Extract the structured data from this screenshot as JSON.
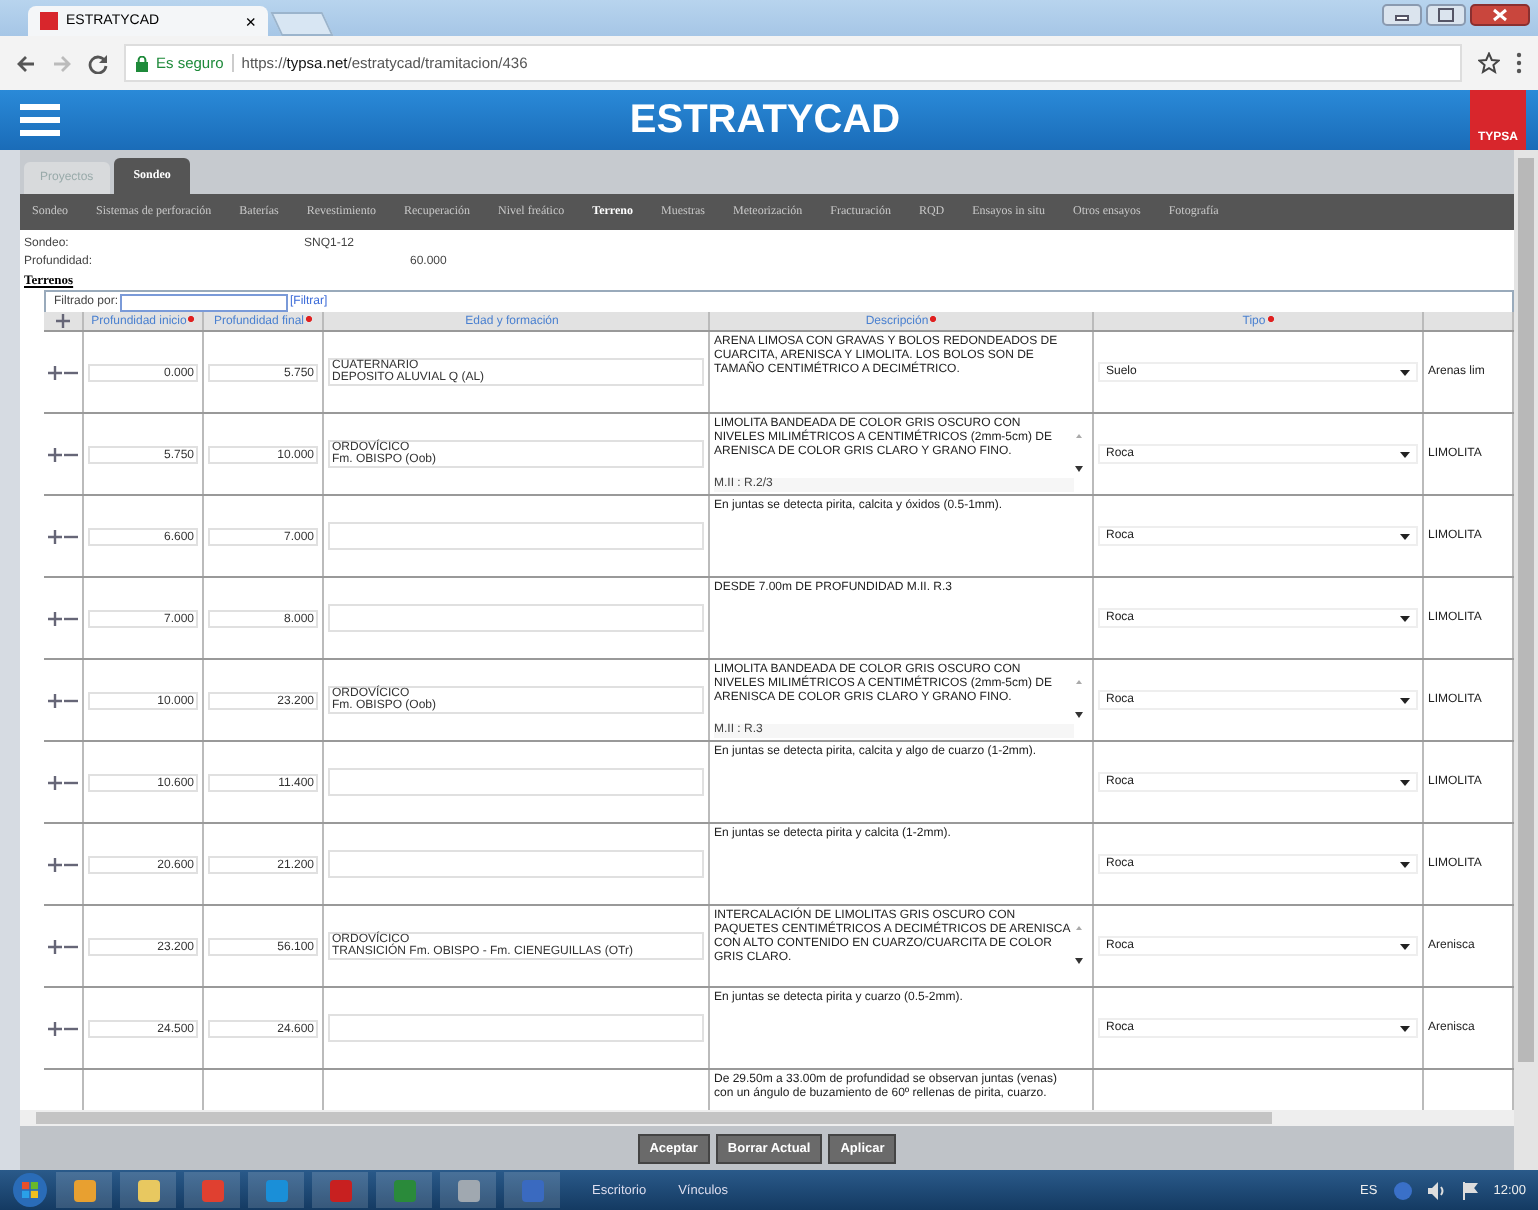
{
  "browser": {
    "tab_title": "ESTRATYCAD",
    "tab_close": "×",
    "secure_label": "Es seguro",
    "url": "https://**typsa.net**/estratycad/tramitacion/436"
  },
  "header": {
    "title": "ESTRATYCAD",
    "logo": "TYPSA"
  },
  "tabs": [
    {
      "label": "Proyectos",
      "selected": false
    },
    {
      "label": "Sondeo",
      "selected": true
    }
  ],
  "subnav": [
    {
      "label": "Sondeo",
      "selected": false
    },
    {
      "label": "Sistemas de perforación",
      "selected": false
    },
    {
      "label": "Baterías",
      "selected": false
    },
    {
      "label": "Revestimiento",
      "selected": false
    },
    {
      "label": "Recuperación",
      "selected": false
    },
    {
      "label": "Nivel freático",
      "selected": false
    },
    {
      "label": "Terreno",
      "selected": true
    },
    {
      "label": "Muestras",
      "selected": false
    },
    {
      "label": "Meteorización",
      "selected": false
    },
    {
      "label": "Fracturación",
      "selected": false
    },
    {
      "label": "RQD",
      "selected": false
    },
    {
      "label": "Ensayos in situ",
      "selected": false
    },
    {
      "label": "Otros ensayos",
      "selected": false
    },
    {
      "label": "Fotografía",
      "selected": false
    }
  ],
  "info": [
    {
      "label": "Sondeo:",
      "value": "SNQ1-12"
    },
    {
      "label": "Profundidad:",
      "value": "60.000"
    }
  ],
  "section_title": "Terrenos",
  "filter": {
    "label": "Filtrado por:",
    "link": "[Filtrar]"
  },
  "columns": [
    {
      "label": "Profundidad inicio",
      "required": true
    },
    {
      "label": "Profundidad final",
      "required": true
    },
    {
      "label": "Edad y formación",
      "required": false
    },
    {
      "label": "Descripción",
      "required": true
    },
    {
      "label": "Tipo",
      "required": true
    }
  ],
  "rows": [
    {
      "start": "0.000",
      "end": "5.750",
      "age": [
        "CUATERNARIO",
        "DEPOSITO ALUVIAL Q (AL)"
      ],
      "description": "ARENA LIMOSA CON GRAVAS Y BOLOS REDONDEADOS DE CUARCITA, ARENISCA Y LIMOLITA. LOS BOLOS SON DE TAMAÑO CENTIMÉTRICO A DECIMÉTRICO.",
      "scrollable": false,
      "type": "Suelo",
      "lithology": "Arenas lim"
    },
    {
      "start": "5.750",
      "end": "10.000",
      "age": [
        "ORDOVÍCICO",
        "Fm. OBISPO (Oob)"
      ],
      "description": "LIMOLITA BANDEADA DE COLOR GRIS OSCURO CON NIVELES MILIMÉTRICOS A CENTIMÉTRICOS (2mm-5cm) DE ARENISCA DE COLOR GRIS CLARO Y GRANO FINO.",
      "note": "M.II : R.2/3",
      "scrollable": true,
      "type": "Roca",
      "lithology": "LIMOLITA"
    },
    {
      "start": "6.600",
      "end": "7.000",
      "description": "En juntas se detecta pirita, calcita y óxidos (0.5-1mm).",
      "scrollable": false,
      "type": "Roca",
      "lithology": "LIMOLITA"
    },
    {
      "start": "7.000",
      "end": "8.000",
      "description": "DESDE 7.00m DE PROFUNDIDAD M.II. R.3",
      "scrollable": false,
      "type": "Roca",
      "lithology": "LIMOLITA"
    },
    {
      "start": "10.000",
      "end": "23.200",
      "age": [
        "ORDOVÍCICO",
        "Fm. OBISPO (Oob)"
      ],
      "description": "LIMOLITA BANDEADA DE COLOR GRIS OSCURO CON NIVELES MILIMÉTRICOS A CENTIMÉTRICOS (2mm-5cm) DE ARENISCA DE COLOR GRIS CLARO Y GRANO FINO.",
      "note": "M.II : R.3",
      "scrollable": true,
      "type": "Roca",
      "lithology": "LIMOLITA"
    },
    {
      "start": "10.600",
      "end": "11.400",
      "description": "En juntas se detecta pirita, calcita y algo de cuarzo (1-2mm).",
      "scrollable": false,
      "type": "Roca",
      "lithology": "LIMOLITA"
    },
    {
      "start": "20.600",
      "end": "21.200",
      "description": "En juntas se detecta pirita y calcita (1-2mm).",
      "scrollable": false,
      "type": "Roca",
      "lithology": "LIMOLITA"
    },
    {
      "start": "23.200",
      "end": "56.100",
      "age": [
        "ORDOVÍCICO",
        "TRANSICIÓN Fm. OBISPO - Fm. CIENEGUILLAS (OTr)"
      ],
      "description": "INTERCALACIÓN DE LIMOLITAS GRIS OSCURO CON PAQUETES CENTIMÉTRICOS A DECIMÉTRICOS DE ARENISCA CON ALTO CONTENIDO EN CUARZO/CUARCITA DE COLOR GRIS CLARO.",
      "scrollable": true,
      "type": "Roca",
      "lithology": "Arenisca"
    },
    {
      "start": "24.500",
      "end": "24.600",
      "description": "En juntas se detecta pirita y cuarzo (0.5-2mm).",
      "scrollable": false,
      "type": "Roca",
      "lithology": "Arenisca"
    },
    {
      "description": "De 29.50m a 33.00m de profundidad se observan juntas (venas) con un ángulo de buzamiento de 60º rellenas de pirita, cuarzo.",
      "scrollable": false
    }
  ],
  "buttons": [
    "Aceptar",
    "Borrar Actual",
    "Aplicar"
  ],
  "taskbar": {
    "toolbars": [
      "Escritorio",
      "Vínculos"
    ],
    "language": "ES",
    "clock": "12:00"
  }
}
